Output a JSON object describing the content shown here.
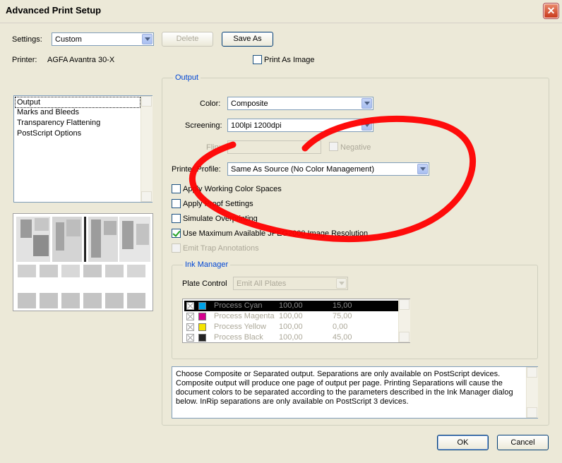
{
  "window": {
    "title": "Advanced Print Setup",
    "close_glyph": "✕"
  },
  "settings": {
    "label": "Settings:",
    "value": "Custom",
    "delete_label": "Delete",
    "save_as_label": "Save As"
  },
  "printer": {
    "label": "Printer:",
    "value": "AGFA Avantra 30-X",
    "print_as_image_label": "Print As Image",
    "print_as_image_checked": false
  },
  "sidebar": {
    "items": [
      {
        "label": "Output",
        "selected": true
      },
      {
        "label": "Marks and Bleeds",
        "selected": false
      },
      {
        "label": "Transparency Flattening",
        "selected": false
      },
      {
        "label": "PostScript Options",
        "selected": false
      }
    ]
  },
  "output": {
    "group_title": "Output",
    "color_label": "Color:",
    "color_value": "Composite",
    "screening_label": "Screening:",
    "screening_value": "100lpi 1200dpi",
    "flip_label": "Flip:",
    "flip_value": "",
    "negative_label": "Negative",
    "negative_checked": false,
    "printer_profile_label": "Printer Profile:",
    "printer_profile_value": "Same As Source (No Color Management)",
    "options": [
      {
        "label": "Apply Working Color Spaces",
        "checked": false,
        "enabled": true
      },
      {
        "label": "Apply Proof Settings",
        "checked": false,
        "enabled": true
      },
      {
        "label": "Simulate Overprinting",
        "checked": false,
        "enabled": true
      },
      {
        "label": "Use Maximum Available JPEG2000 Image Resolution",
        "checked": true,
        "enabled": true
      },
      {
        "label": "Emit Trap Annotations",
        "checked": false,
        "enabled": false
      }
    ]
  },
  "ink_manager": {
    "title": "Ink Manager",
    "plate_control_label": "Plate Control",
    "plate_control_value": "Emit All Plates",
    "plates": [
      {
        "name": "Process Cyan",
        "frequency": "100,00",
        "angle": "15,00",
        "color": "#00a2e8",
        "selected": true
      },
      {
        "name": "Process Magenta",
        "frequency": "100,00",
        "angle": "75,00",
        "color": "#d6008f",
        "selected": false
      },
      {
        "name": "Process Yellow",
        "frequency": "100,00",
        "angle": "0,00",
        "color": "#f5e400",
        "selected": false
      },
      {
        "name": "Process Black",
        "frequency": "100,00",
        "angle": "45,00",
        "color": "#222222",
        "selected": false
      }
    ]
  },
  "description": "Choose Composite or Separated output. Separations are only available on PostScript devices. Composite output will produce one page of output per page. Printing Separations will cause the document colors to be separated according to the parameters described in the Ink Manager dialog below. InRip separations are only available on PostScript 3 devices.",
  "footer": {
    "ok_label": "OK",
    "cancel_label": "Cancel"
  },
  "colors": {
    "accent": "#0046d5",
    "selection": "#000000",
    "annotation": "#ff0000",
    "dialog_bg": "#ece9d8"
  }
}
